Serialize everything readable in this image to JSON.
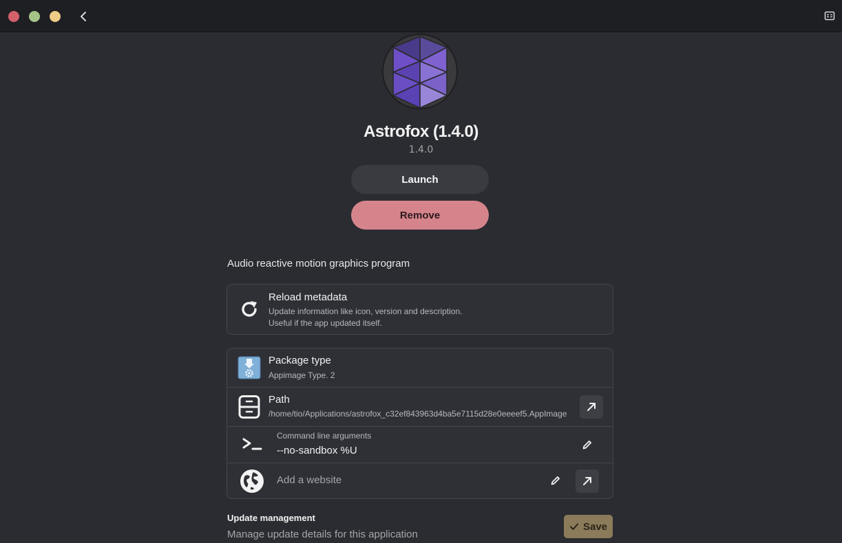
{
  "window": {
    "controls": [
      "close",
      "minimize",
      "maximize"
    ],
    "back_icon": "chevron-left-icon",
    "menu_icon": "menu-icon"
  },
  "app": {
    "title": "Astrofox (1.4.0)",
    "version": "1.4.0",
    "icon": "astrofox-logo",
    "launch_label": "Launch",
    "remove_label": "Remove",
    "description": "Audio reactive motion graphics program"
  },
  "reload": {
    "title": "Reload metadata",
    "line1": "Update information like icon, version and description.",
    "line2": "Useful if the app updated itself.",
    "icon": "reload-icon"
  },
  "package": {
    "title": "Package type",
    "value": "Appimage Type. 2",
    "icon": "package-icon"
  },
  "path": {
    "title": "Path",
    "value": "/home/tio/Applications/astrofox_c32ef843963d4ba5e7115d28e0eeeef5.AppImage",
    "icon": "cabinet-icon",
    "open_icon": "open-external-icon"
  },
  "cmd": {
    "label": "Command line arguments",
    "value": "--no-sandbox %U",
    "icon": "terminal-icon",
    "edit_icon": "pencil-icon"
  },
  "website": {
    "placeholder": "Add a website",
    "icon": "globe-icon",
    "edit_icon": "pencil-icon",
    "open_icon": "open-external-icon"
  },
  "updates": {
    "title": "Update management",
    "subtitle": "Manage update details for this application",
    "save_label": "Save"
  },
  "colors": {
    "background": "#2b2c31",
    "titlebar": "#1e1f23",
    "remove": "#d6848c",
    "save": "#8b7b5a",
    "accent_purple": "#7257c9"
  }
}
